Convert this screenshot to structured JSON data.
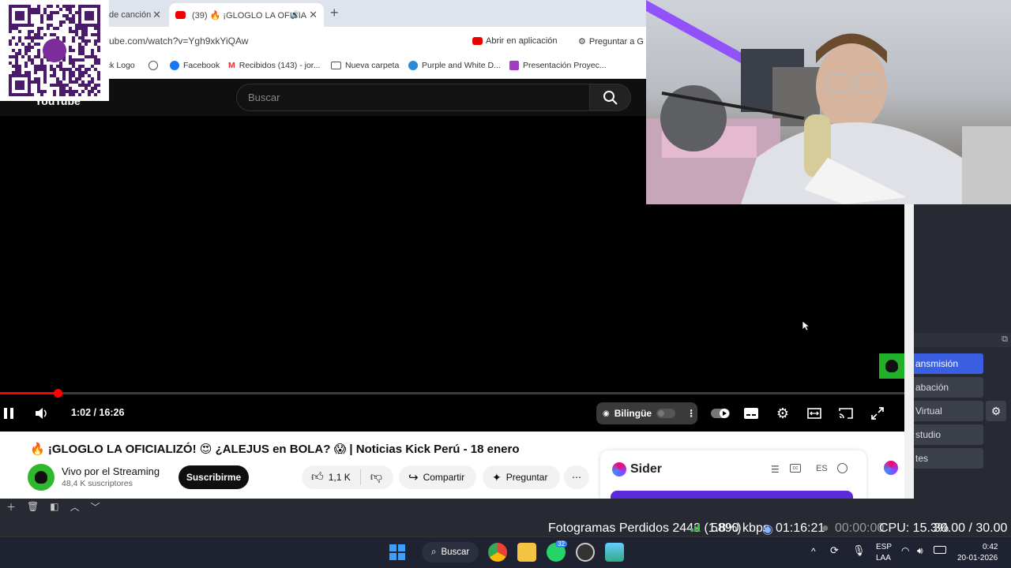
{
  "browser": {
    "tabs": [
      {
        "title": "de canción"
      },
      {
        "title": "(39) 🔥 ¡GLOGLO LA OFICIA"
      }
    ],
    "new_tab": "+",
    "close": "✕",
    "url": "ube.com/watch?v=Ygh9xkYiQAw",
    "open_in_app": "Abrir en aplicación",
    "ask": "Preguntar a G",
    "bookmarks": [
      "ck Logo",
      "Facebook",
      "Recibidos (143) - jor...",
      "Nueva carpeta",
      "Purple and White D...",
      "Presentación Proyec..."
    ]
  },
  "youtube": {
    "logo": "YouTube",
    "search_placeholder": "Buscar",
    "progress": 0.064,
    "time": "1:02 / 16:26",
    "bilingual": "Bilingüe",
    "video_title": "🔥 ¡GLOGLO LA OFICIALIZÓ! 😍 ¿ALEJUS en BOLA? 😱 | Noticias Kick Perú - 18 enero",
    "channel": "Vivo por el Streaming",
    "subscribers": "48,4 K suscriptores",
    "subscribe": "Suscribirme",
    "likes": "1,1 K",
    "share": "Compartir",
    "ask": "Preguntar",
    "more": "⋯"
  },
  "sider": {
    "title": "Sider",
    "lang": "ES"
  },
  "obs": {
    "buttons": [
      "ansmisión",
      "abación",
      "Virtual",
      "studio",
      "tes"
    ],
    "status": {
      "dropped": "Fotogramas Perdidos 2442 (1.8%)",
      "bitrate": "5890 kbps",
      "stream_time": "01:16:21",
      "rec_time": "00:00:00",
      "cpu": "CPU: 15.3%",
      "fps": "30.00 / 30.00 FPS"
    }
  },
  "taskbar": {
    "search": "Buscar",
    "whatsapp_badge": "32",
    "lang_top": "ESP",
    "lang_bottom": "LAA",
    "time": "0:42",
    "date": "20-01-2026"
  },
  "colors": {
    "yt_red": "#ff0000",
    "obs_blue": "#3a5fe0",
    "sider_purple": "#5b2bdc",
    "channel_green": "#2eb82e"
  }
}
